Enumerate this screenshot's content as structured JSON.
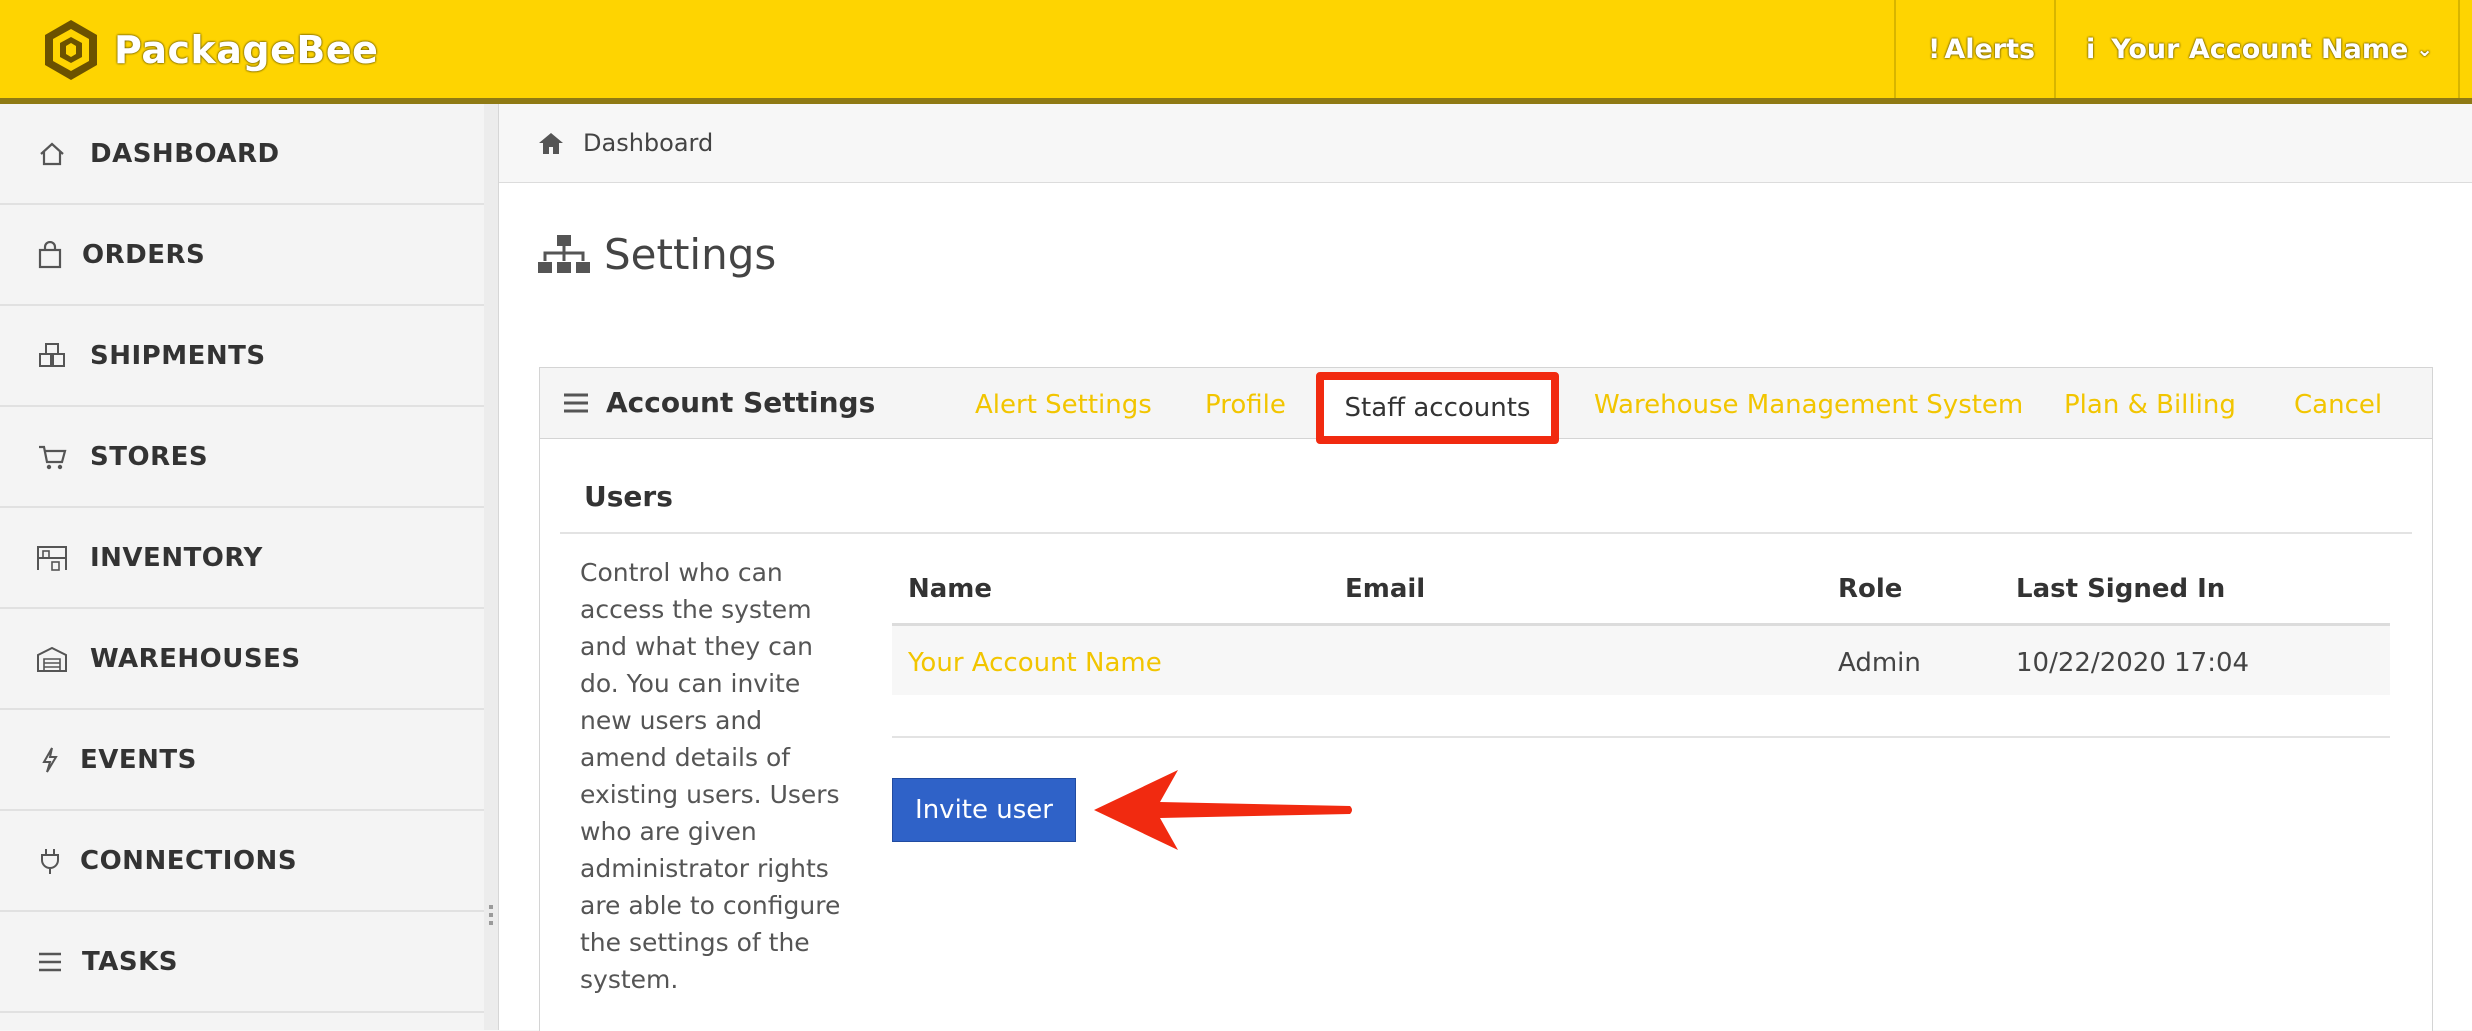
{
  "brand": {
    "name": "PackageBee",
    "color": "#fed401"
  },
  "topbar": {
    "alerts_label": "Alerts",
    "alerts_icon": "exclamation-icon",
    "account_label": "Your Account Name",
    "account_icon": "info-icon"
  },
  "sidebar": {
    "items": [
      {
        "label": "DASHBOARD",
        "icon": "home-icon"
      },
      {
        "label": "ORDERS",
        "icon": "shopping-bag-icon"
      },
      {
        "label": "SHIPMENTS",
        "icon": "boxes-icon"
      },
      {
        "label": "STORES",
        "icon": "cart-icon"
      },
      {
        "label": "INVENTORY",
        "icon": "warehouse-rack-icon"
      },
      {
        "label": "WAREHOUSES",
        "icon": "warehouse-icon"
      },
      {
        "label": "EVENTS",
        "icon": "bolt-icon"
      },
      {
        "label": "CONNECTIONS",
        "icon": "plug-icon"
      },
      {
        "label": "TASKS",
        "icon": "list-icon"
      }
    ]
  },
  "breadcrumb": {
    "label": "Dashboard"
  },
  "page": {
    "title": "Settings"
  },
  "panel": {
    "title": "Account Settings",
    "tabs": [
      {
        "label": "Alert Settings"
      },
      {
        "label": "Profile"
      },
      {
        "label": "Staff accounts",
        "active": true
      },
      {
        "label": "Warehouse Management System"
      },
      {
        "label": "Plan & Billing"
      },
      {
        "label": "Cancel"
      }
    ]
  },
  "users": {
    "heading": "Users",
    "description": "Control who can access the system and what they can do. You can invite new users and amend details of existing users. Users who are given administrator rights are able to configure the settings of the system.",
    "columns": [
      "Name",
      "Email",
      "Role",
      "Last Signed In"
    ],
    "rows": [
      {
        "name": "Your Account Name",
        "email": "",
        "role": "Admin",
        "last_signed_in": "10/22/2020 17:04"
      }
    ],
    "invite_label": "Invite user"
  },
  "colors": {
    "accent": "#f2c500",
    "highlight": "#f12a10",
    "button": "#2f62c8"
  }
}
